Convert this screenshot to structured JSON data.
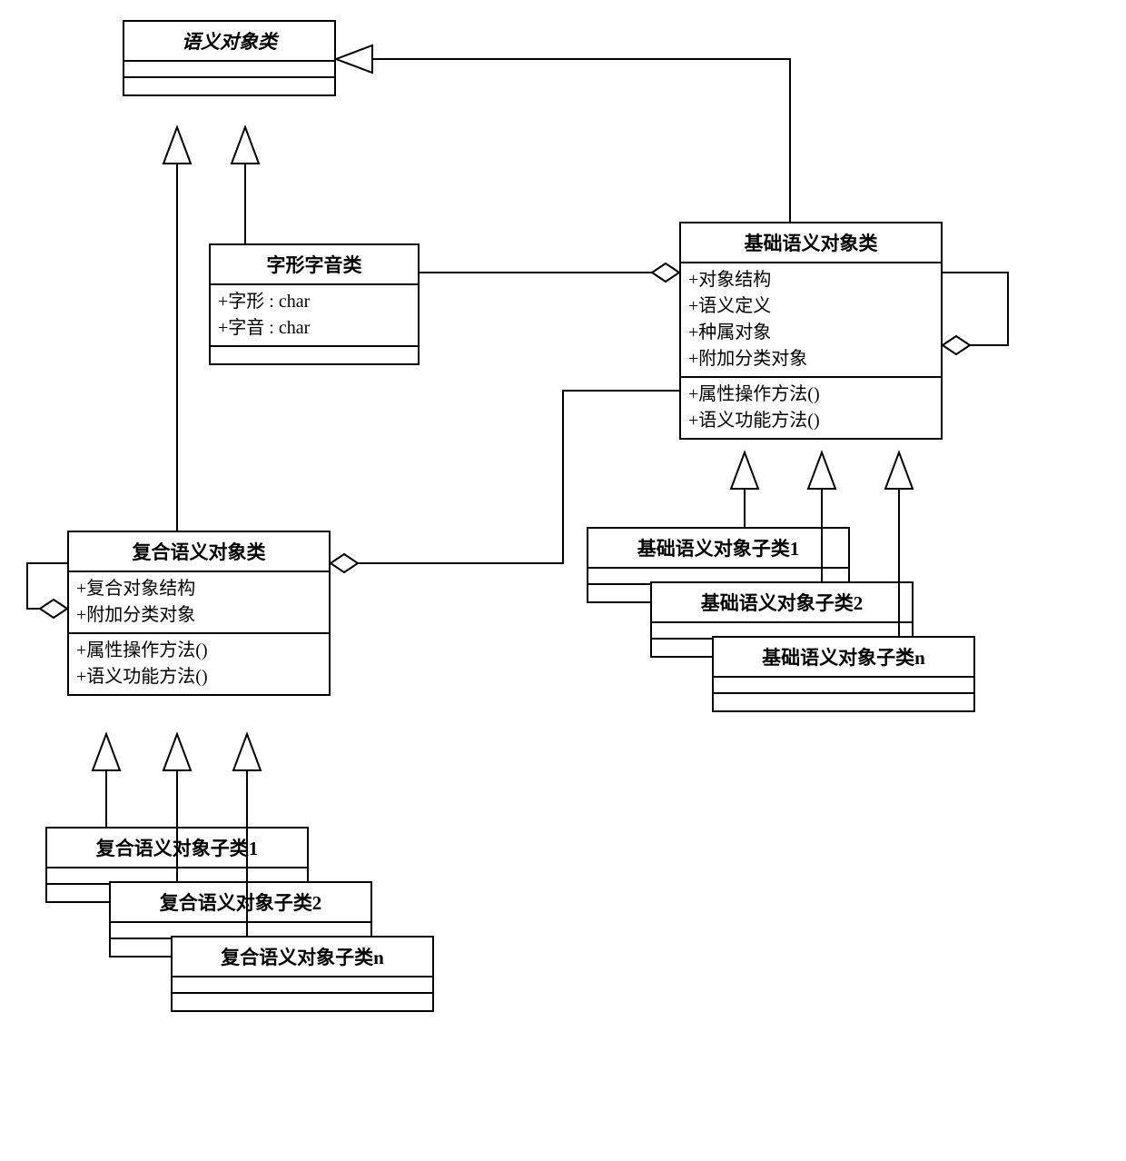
{
  "classes": {
    "semanticObject": {
      "name": "语义对象类",
      "attrs": [],
      "ops": []
    },
    "glyphPhonetic": {
      "name": "字形字音类",
      "attrs": [
        "+字形 : char",
        "+字音 : char"
      ],
      "ops": []
    },
    "baseSemantic": {
      "name": "基础语义对象类",
      "attrs": [
        "+对象结构",
        "+语义定义",
        "+种属对象",
        "+附加分类对象"
      ],
      "ops": [
        "+属性操作方法()",
        "+语义功能方法()"
      ]
    },
    "compositeSemantic": {
      "name": "复合语义对象类",
      "attrs": [
        "+复合对象结构",
        "+附加分类对象"
      ],
      "ops": [
        "+属性操作方法()",
        "+语义功能方法()"
      ]
    },
    "baseSub1": {
      "name": "基础语义对象子类1"
    },
    "baseSub2": {
      "name": "基础语义对象子类2"
    },
    "baseSubN": {
      "name": "基础语义对象子类n"
    },
    "compSub1": {
      "name": "复合语义对象子类1"
    },
    "compSub2": {
      "name": "复合语义对象子类2"
    },
    "compSubN": {
      "name": "复合语义对象子类n"
    }
  },
  "relations": [
    {
      "kind": "generalization",
      "from": "compositeSemantic",
      "to": "semanticObject"
    },
    {
      "kind": "generalization",
      "from": "glyphPhonetic",
      "to": "semanticObject"
    },
    {
      "kind": "generalization",
      "from": "baseSemantic",
      "to": "semanticObject"
    },
    {
      "kind": "aggregation",
      "from": "glyphPhonetic",
      "to": "baseSemantic"
    },
    {
      "kind": "aggregation",
      "from": "baseSemantic",
      "to": "compositeSemantic"
    },
    {
      "kind": "aggregation-self",
      "on": "baseSemantic"
    },
    {
      "kind": "aggregation-self",
      "on": "compositeSemantic"
    },
    {
      "kind": "generalization",
      "from": "baseSub1",
      "to": "baseSemantic"
    },
    {
      "kind": "generalization",
      "from": "baseSub2",
      "to": "baseSemantic"
    },
    {
      "kind": "generalization",
      "from": "baseSubN",
      "to": "baseSemantic"
    },
    {
      "kind": "generalization",
      "from": "compSub1",
      "to": "compositeSemantic"
    },
    {
      "kind": "generalization",
      "from": "compSub2",
      "to": "compositeSemantic"
    },
    {
      "kind": "generalization",
      "from": "compSubN",
      "to": "compositeSemantic"
    }
  ]
}
